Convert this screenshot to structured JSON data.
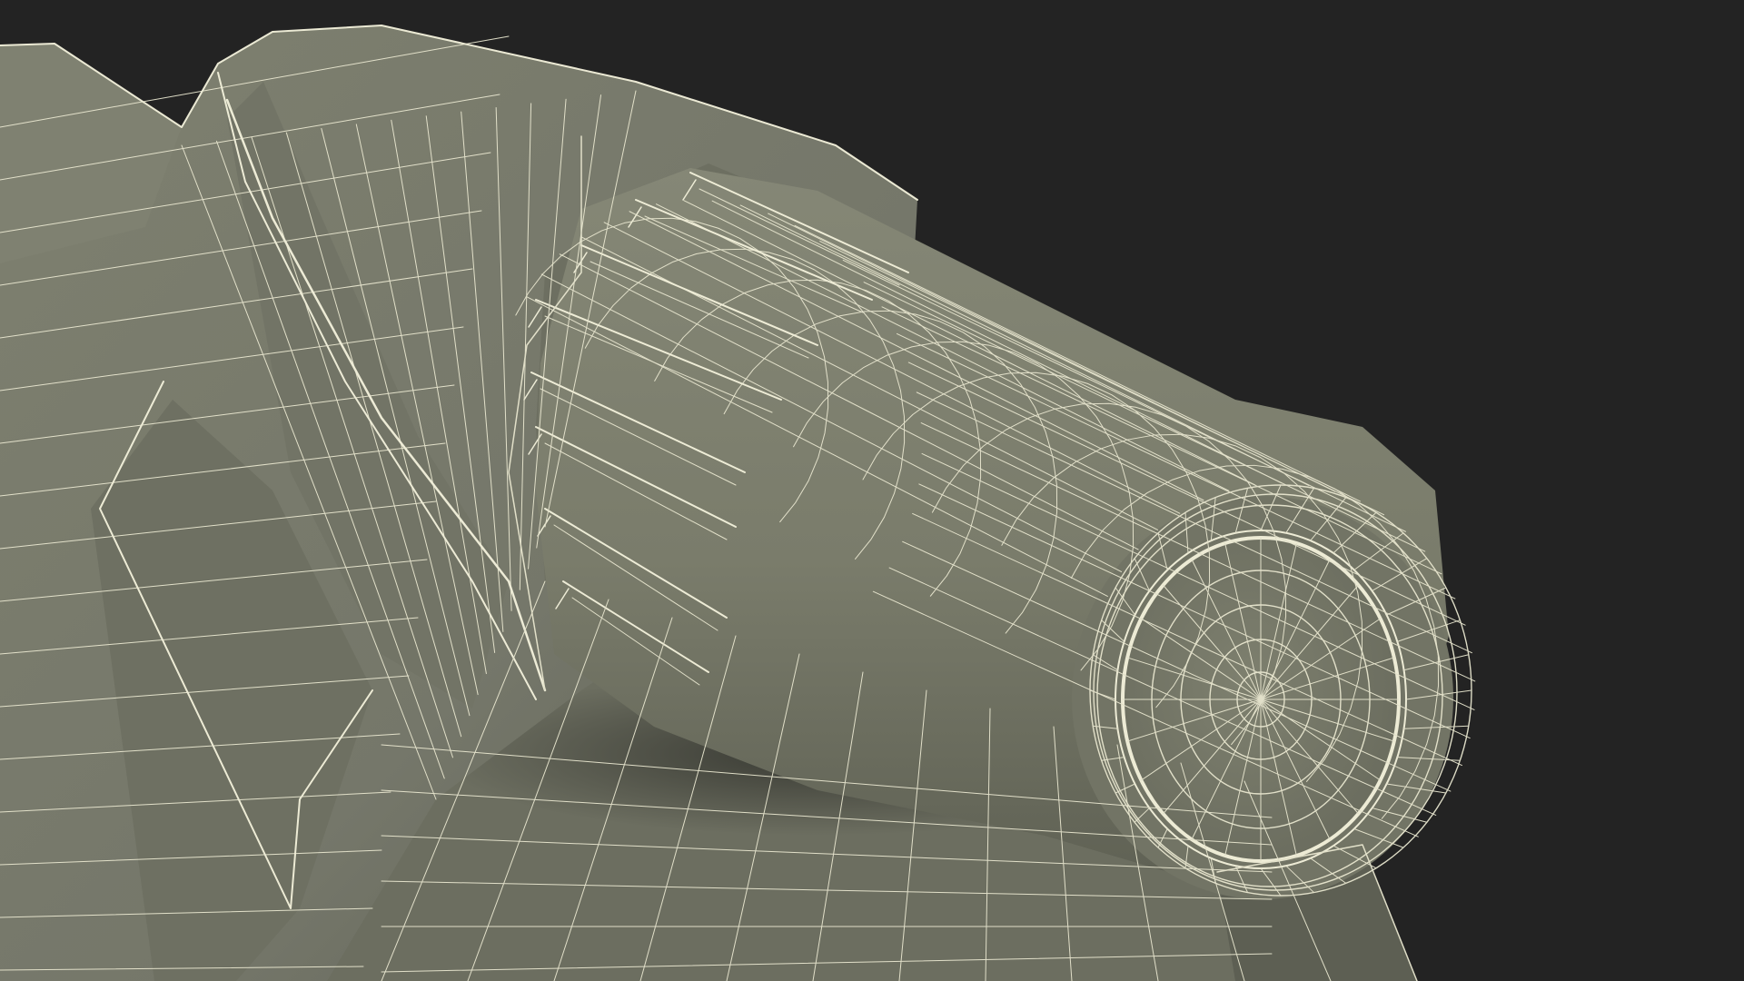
{
  "scene": {
    "subject": "wireframe-3d-model-knob",
    "colors": {
      "background": "#232323",
      "surface": "#7b7d6c",
      "surface_light": "#868877",
      "surface_dark": "#5f6154",
      "shadow": "#3a3b34",
      "wire": "#e8e6cf",
      "wire_bright": "#f4f2dc"
    }
  }
}
